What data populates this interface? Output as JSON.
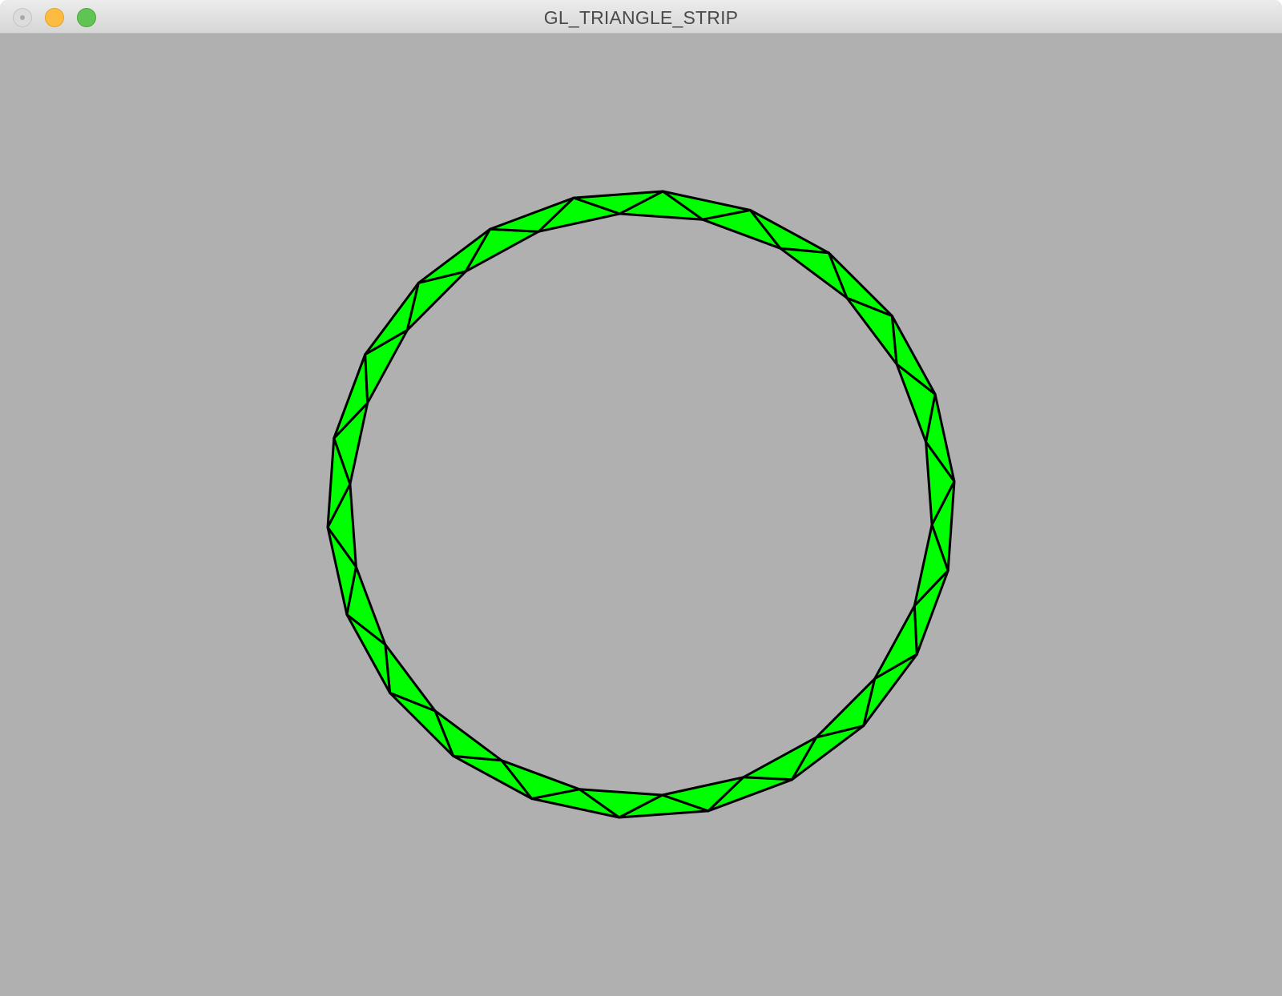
{
  "window": {
    "title": "GL_TRIANGLE_STRIP"
  },
  "colors": {
    "background": "#b0b0b0",
    "fill": "#00ff00",
    "outline": "#000000"
  },
  "icons": {
    "close": "close-icon",
    "minimize": "minimize-icon",
    "zoom": "zoom-icon"
  },
  "scene": {
    "primitive": "GL_TRIANGLE_STRIP",
    "shape": "ring",
    "segments": 22
  }
}
